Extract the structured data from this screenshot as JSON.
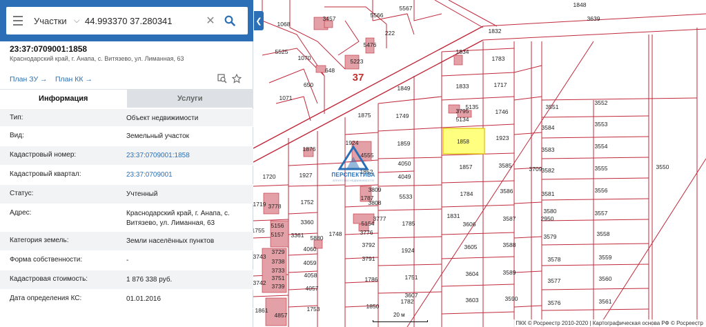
{
  "search": {
    "layer": "Участки",
    "query": "44.993370 37.280341"
  },
  "parcel": {
    "id": "23:37:0709001:1858",
    "address": "Краснодарский край, г. Анапа, с. Витязево, ул. Лиманная, 63",
    "links": {
      "plan_zu": "План ЗУ →",
      "plan_kk": "План КК →"
    }
  },
  "tabs": {
    "info": "Информация",
    "services": "Услуги"
  },
  "info": [
    {
      "key": "Тип:",
      "value": "Объект недвижимости"
    },
    {
      "key": "Вид:",
      "value": "Земельный участок"
    },
    {
      "key": "Кадастровый номер:",
      "value": "23:37:0709001:1858"
    },
    {
      "key": "Кадастровый квартал:",
      "value": "23:37:0709001"
    },
    {
      "key": "Статус:",
      "value": "Учтенный"
    },
    {
      "key": "Адрес:",
      "value": "Краснодарский край, г. Анапа, с. Витязево, ул. Лиманная, 63"
    },
    {
      "key": "Категория земель:",
      "value": "Земли населённых пунктов"
    },
    {
      "key": "Форма собственности:",
      "value": "-"
    },
    {
      "key": "Кадастровая стоимость:",
      "value": "1 876 338 руб."
    },
    {
      "key": "Дата определения КС:",
      "value": "01.01.2016"
    }
  ],
  "map": {
    "quarter_label": "37",
    "highlighted_parcel": "1858",
    "scale": "20 м",
    "attribution": "ПКК © Росреестр 2010-2020 | Картографическая основа РФ © Росреестр",
    "watermark": "ПЕРСПЕКТИВА",
    "watermark_sub": "АГЕНТСТВО НЕДВИЖИМОСТИ",
    "colors": {
      "line": "#c0283a",
      "building": "#e3a0a6",
      "highlight": "#ffff80",
      "accent": "#2c6fb6"
    },
    "labels": [
      "1848",
      "3639",
      "1832",
      "1783",
      "1834",
      "1833",
      "1717",
      "1849",
      "1875",
      "1749",
      "5135",
      "5134",
      "3795",
      "1746",
      "1858",
      "1923",
      "1876",
      "1859",
      "1924",
      "4555",
      "1852",
      "4050",
      "4049",
      "1857",
      "3585",
      "3551",
      "3552",
      "3584",
      "3553",
      "3583",
      "3554",
      "3582",
      "3555",
      "3581",
      "3556",
      "3580",
      "3557",
      "2950",
      "3579",
      "3558",
      "3578",
      "3559",
      "3577",
      "3560",
      "3576",
      "3561",
      "1720",
      "1927",
      "3809",
      "3808",
      "5533",
      "1787",
      "1784",
      "3586",
      "1719",
      "1752",
      "3778",
      "3360",
      "3777",
      "1748",
      "5154",
      "3776",
      "1785",
      "1831",
      "3606",
      "3587",
      "5156",
      "3361",
      "5880",
      "3792",
      "1924",
      "3605",
      "3588",
      "5157",
      "4060",
      "3791",
      "1755",
      "3743",
      "3729",
      "3738",
      "4059",
      "3733",
      "4058",
      "3751",
      "3742",
      "3739",
      "4057",
      "1786",
      "1751",
      "3604",
      "3589",
      "1850",
      "3607",
      "3603",
      "3590",
      "1782",
      "1861",
      "4857",
      "1753",
      "1068",
      "3457",
      "5566",
      "5567",
      "222",
      "5525",
      "1070",
      "5476",
      "5223",
      "648",
      "650",
      "1071",
      "3709",
      "3550"
    ]
  }
}
